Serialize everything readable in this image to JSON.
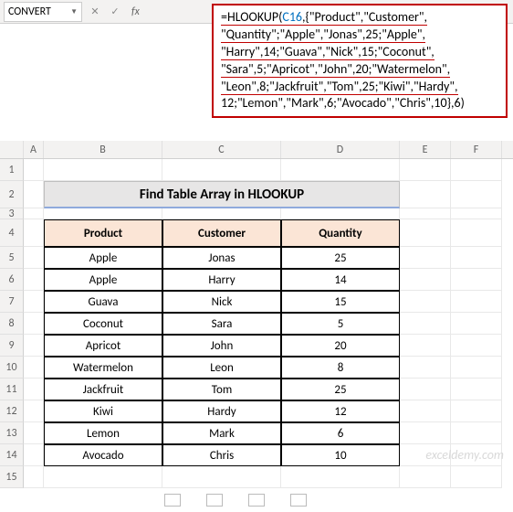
{
  "namebox": {
    "value": "CONVERT"
  },
  "formula_bar": {
    "prefix": "=HLOOKUP(",
    "ref": "C16",
    "line1_rest": ",{\"Product\",\"Customer\",",
    "line2": "\"Quantity\";\"Apple\",\"Jonas\",25;\"Apple\",",
    "line3": "\"Harry\",14;\"Guava\",\"Nick\",15;\"Coconut\",",
    "line4": "\"Sara\",5;\"Apricot\",\"John\",20;\"Watermelon\",",
    "line5": "\"Leon\",8;\"Jackfruit\",\"Tom\",25;\"Kiwi\",\"Hardy\",",
    "line6": "12;\"Lemon\",\"Mark\",6;\"Avocado\",\"Chris\",10},6)"
  },
  "columns": [
    "A",
    "B",
    "C",
    "D",
    "E",
    "F"
  ],
  "row_nums": [
    "1",
    "2",
    "3",
    "4",
    "5",
    "6",
    "7",
    "8",
    "9",
    "10",
    "11",
    "12",
    "13",
    "14",
    "15"
  ],
  "title": "Find Table Array in HLOOKUP",
  "headers": {
    "b": "Product",
    "c": "Customer",
    "d": "Quantity"
  },
  "table": [
    {
      "product": "Apple",
      "customer": "Jonas",
      "qty": "25"
    },
    {
      "product": "Apple",
      "customer": "Harry",
      "qty": "14"
    },
    {
      "product": "Guava",
      "customer": "Nick",
      "qty": "15"
    },
    {
      "product": "Coconut",
      "customer": "Sara",
      "qty": "5"
    },
    {
      "product": "Apricot",
      "customer": "John",
      "qty": "20"
    },
    {
      "product": "Watermelon",
      "customer": "Leon",
      "qty": "8"
    },
    {
      "product": "Jackfruit",
      "customer": "Tom",
      "qty": "25"
    },
    {
      "product": "Kiwi",
      "customer": "Hardy",
      "qty": "12"
    },
    {
      "product": "Lemon",
      "customer": "Mark",
      "qty": "6"
    },
    {
      "product": "Avocado",
      "customer": "Chris",
      "qty": "10"
    }
  ],
  "fx": {
    "cancel": "✕",
    "accept": "✓",
    "label": "fx"
  },
  "watermark": "exceldemy.com",
  "chart_data": {
    "type": "table",
    "title": "Find Table Array in HLOOKUP",
    "columns": [
      "Product",
      "Customer",
      "Quantity"
    ],
    "rows": [
      [
        "Apple",
        "Jonas",
        25
      ],
      [
        "Apple",
        "Harry",
        14
      ],
      [
        "Guava",
        "Nick",
        15
      ],
      [
        "Coconut",
        "Sara",
        5
      ],
      [
        "Apricot",
        "John",
        20
      ],
      [
        "Watermelon",
        "Leon",
        8
      ],
      [
        "Jackfruit",
        "Tom",
        25
      ],
      [
        "Kiwi",
        "Hardy",
        12
      ],
      [
        "Lemon",
        "Mark",
        6
      ],
      [
        "Avocado",
        "Chris",
        10
      ]
    ]
  }
}
